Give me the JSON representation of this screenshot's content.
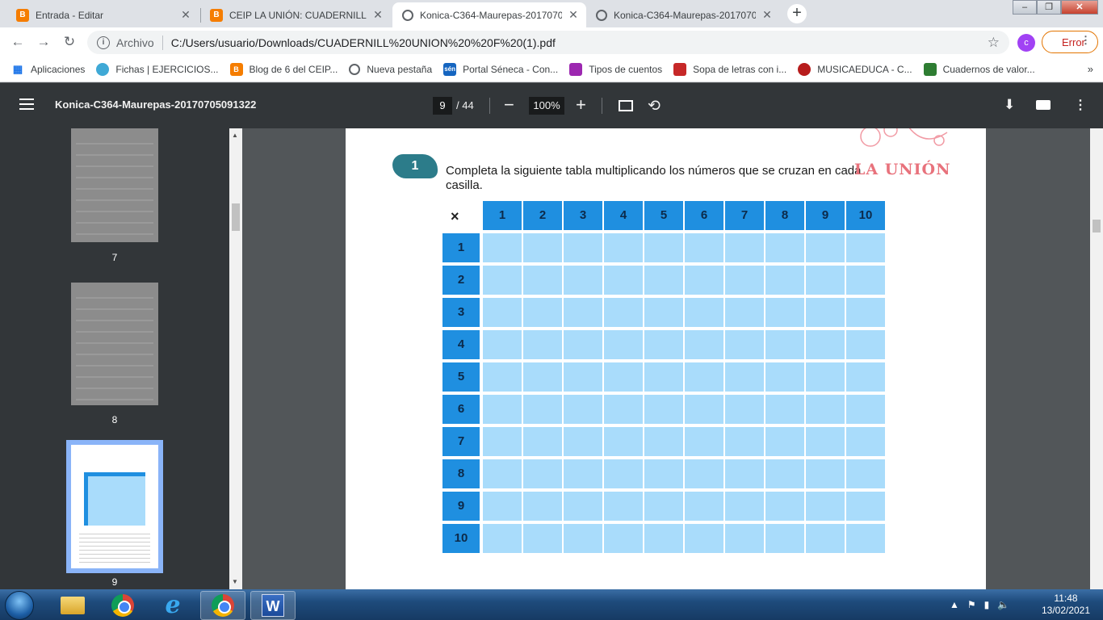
{
  "browser": {
    "tabs": [
      {
        "title": "Entrada - Editar",
        "icon": "blogger-icon",
        "color": "#f57d00",
        "active": false
      },
      {
        "title": "CEIP LA UNIÓN: CUADERNILLOS",
        "icon": "blogger-icon",
        "color": "#f57d00",
        "active": false
      },
      {
        "title": "Konica-C364-Maurepas-2017070",
        "icon": "globe-icon",
        "color": "#5f6368",
        "active": true
      },
      {
        "title": "Konica-C364-Maurepas-2017070",
        "icon": "globe-icon",
        "color": "#5f6368",
        "active": false
      }
    ],
    "new_tab": "+",
    "address": {
      "scheme_label": "Archivo",
      "url": "C:/Users/usuario/Downloads/CUADERNILL%20UNION%20%20F%20(1).pdf"
    },
    "profile_initial": "c",
    "error_label": "Error",
    "bookmarks": [
      {
        "label": "Aplicaciones",
        "icon": "apps-grid-icon",
        "color": "#1a73e8"
      },
      {
        "label": "Fichas | EJERCICIOS...",
        "icon": "site-icon",
        "color": "#3fa9d6"
      },
      {
        "label": "Blog de 6 del CEIP...",
        "icon": "blogger-icon",
        "color": "#f57d00"
      },
      {
        "label": "Nueva pestaña",
        "icon": "globe-icon",
        "color": "#5f6368"
      },
      {
        "label": "Portal Séneca - Con...",
        "icon": "seneca-icon",
        "color": "#1565c0"
      },
      {
        "label": "Tipos de cuentos",
        "icon": "site-icon",
        "color": "#9c27b0"
      },
      {
        "label": "Sopa de letras con i...",
        "icon": "site-icon",
        "color": "#c62828"
      },
      {
        "label": "MUSICAEDUCA - C...",
        "icon": "site-icon",
        "color": "#b71c1c"
      },
      {
        "label": "Cuadernos de valor...",
        "icon": "site-icon",
        "color": "#2e7d32"
      }
    ],
    "bookmarks_more": "»"
  },
  "pdf": {
    "title": "Konica-C364-Maurepas-20170705091322",
    "current_page": "9",
    "total_pages": "/ 44",
    "zoom": "100%",
    "thumbnails": [
      {
        "label": "7"
      },
      {
        "label": "8"
      },
      {
        "label": "9",
        "selected": true
      }
    ],
    "document": {
      "exercise_number": "1",
      "instruction": "Completa la siguiente tabla multiplicando los números que se cruzan en cada casilla.",
      "logo_text": "LA UNIÓN",
      "times_symbol": "×",
      "column_headers": [
        "1",
        "2",
        "3",
        "4",
        "5",
        "6",
        "7",
        "8",
        "9",
        "10"
      ],
      "row_headers": [
        "1",
        "2",
        "3",
        "4",
        "5",
        "6",
        "7",
        "8",
        "9",
        "10"
      ]
    }
  },
  "taskbar": {
    "apps": [
      {
        "name": "explorer",
        "icon": "folder-icon"
      },
      {
        "name": "chrome",
        "icon": "chrome-icon"
      },
      {
        "name": "internet-explorer",
        "icon": "ie-icon"
      },
      {
        "name": "chrome-active",
        "icon": "chrome-icon"
      },
      {
        "name": "word",
        "icon": "word-icon",
        "glyph": "W"
      }
    ],
    "time": "11:48",
    "date": "13/02/2021"
  },
  "colors": {
    "header_blue": "#1f8fe0",
    "cell_blue": "#a9dcfb",
    "pdf_toolbar": "#323639"
  }
}
